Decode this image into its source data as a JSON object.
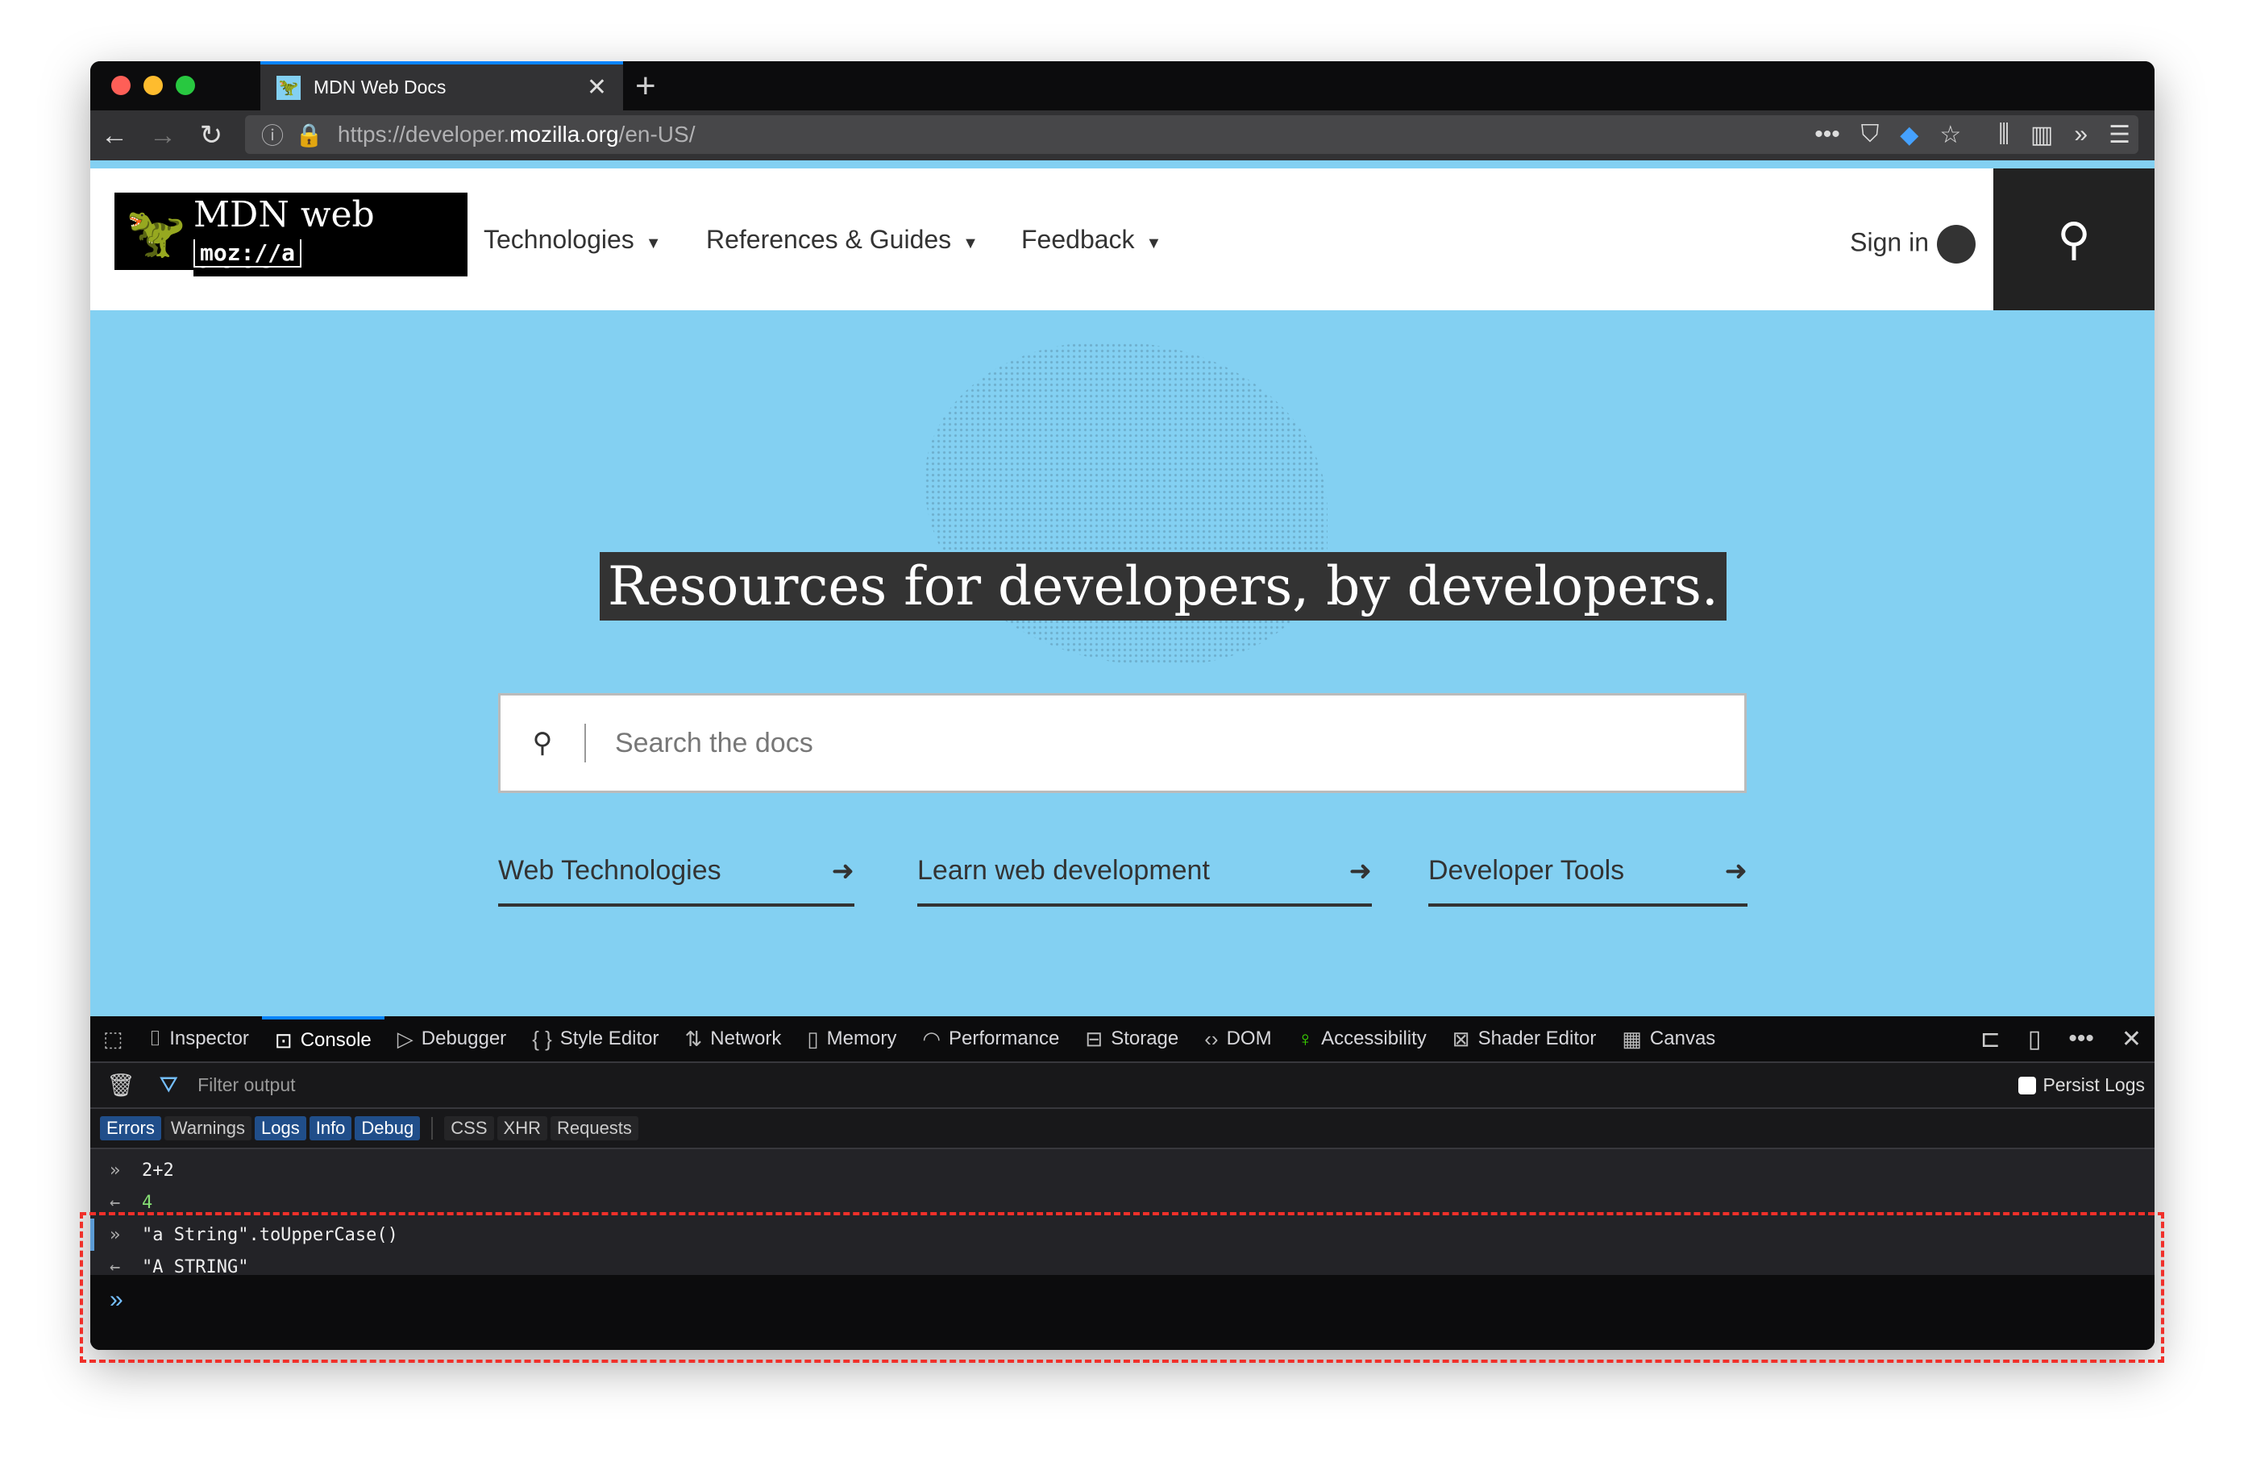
{
  "browser": {
    "tab_title": "MDN Web Docs",
    "url_prefix": "https://developer.",
    "url_domain": "mozilla.org",
    "url_path": "/en-US/",
    "accent": "#0a84ff"
  },
  "mdn": {
    "logo_text": "MDN web docs",
    "logo_sub": "moz://a",
    "nav": [
      "Technologies",
      "References & Guides",
      "Feedback"
    ],
    "sign_in": "Sign in",
    "headline": "Resources for developers, by developers.",
    "search_placeholder": "Search the docs",
    "categories": [
      "Web Technologies",
      "Learn web development",
      "Developer Tools"
    ],
    "hero_color": "#83d0f2"
  },
  "devtools": {
    "tabs": [
      "Inspector",
      "Console",
      "Debugger",
      "Style Editor",
      "Network",
      "Memory",
      "Performance",
      "Storage",
      "DOM",
      "Accessibility",
      "Shader Editor",
      "Canvas"
    ],
    "selected": "Console",
    "filter_placeholder": "Filter output",
    "persist_logs": "Persist Logs",
    "levels": [
      "Errors",
      "Warnings",
      "Logs",
      "Info",
      "Debug"
    ],
    "levels_on": [
      "Errors",
      "Logs",
      "Info",
      "Debug"
    ],
    "types": [
      "CSS",
      "XHR",
      "Requests"
    ],
    "console": [
      {
        "kind": "input",
        "text": "2+2"
      },
      {
        "kind": "result",
        "text": "4"
      },
      {
        "kind": "input",
        "text": "\"a String\".toUpperCase()"
      },
      {
        "kind": "result",
        "text": "\"A STRING\""
      }
    ]
  }
}
